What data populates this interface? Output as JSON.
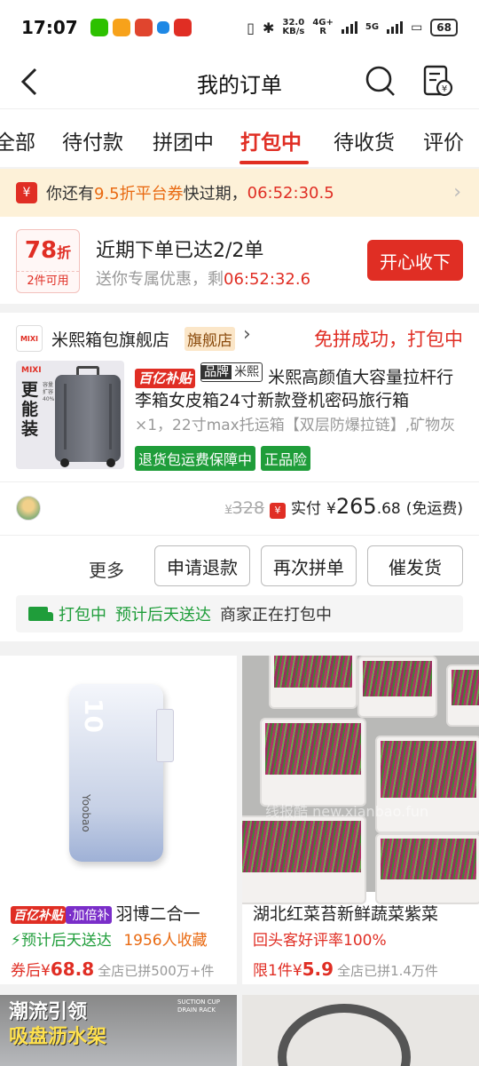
{
  "status_bar": {
    "time": "17:07",
    "net_speed": "32.0",
    "net_unit": "KB/s",
    "net_type": "4G+",
    "net_type_sub": "R",
    "wifi": "5G",
    "battery": "68"
  },
  "nav": {
    "title": "我的订单"
  },
  "tabs": [
    {
      "label": "全部"
    },
    {
      "label": "待付款"
    },
    {
      "label": "拼团中"
    },
    {
      "label": "打包中"
    },
    {
      "label": "待收货"
    },
    {
      "label": "评价"
    }
  ],
  "banner": {
    "icon": "¥",
    "prefix": "你还有",
    "highlight": "9.5折平台券",
    "middle": "快过期，",
    "countdown": "06:52:30.5"
  },
  "promo": {
    "discount": "78",
    "discount_unit": "折",
    "sub": "2件可用",
    "line1": "近期下单已达2/2单",
    "line2_prefix": "送你专属优惠，剩",
    "line2_countdown": "06:52:32.6",
    "button": "开心收下"
  },
  "order": {
    "shop_logo": "MIXI",
    "shop_name": "米熙箱包旗舰店",
    "shop_tag": "旗舰店",
    "status": "免拼成功，打包中",
    "img_brand": "MIXI",
    "img_text": "更能装",
    "img_sub": "容量扩容40%",
    "tag_bybt": "百亿补贴",
    "tag_brand_label": "品牌",
    "tag_brand_name": "米熙",
    "title": "米熙高颜值大容量拉杆行李箱女皮箱24寸新款登机密码旅行箱",
    "spec": "×1，22寸max托运箱【双层防爆拉链】,矿物灰",
    "service_tags": [
      "退货包运费保障中",
      "正品险"
    ],
    "orig_yen": "¥",
    "orig_price": "328",
    "paid_icon": "¥",
    "paid_label": "实付",
    "paid_yen": "¥",
    "paid_int": "265",
    "paid_dec": ".68",
    "shipping_note": "(免运费)",
    "more": "更多",
    "actions": [
      "申请退款",
      "再次拼单",
      "催发货"
    ],
    "ship_status": "打包中",
    "ship_eta": "预计后天送达",
    "ship_note": "商家正在打包中"
  },
  "recommendations": [
    {
      "img_num": "10",
      "img_label": "Yoobao",
      "tag1": "百亿补贴",
      "tag2": "·加倍补",
      "title": "羽博二合一",
      "bolt": "⚡",
      "eta": "预计后天送达",
      "favs": "1956人收藏",
      "price_prefix": "券后¥",
      "price": "68.8",
      "sold": "全店已拼500万+件"
    },
    {
      "watermark": "线报酷 new.xianbao.fun",
      "title": "湖北红菜苔新鲜蔬菜紫菜",
      "highlight": "回头客好评率100%",
      "price_prefix": "限1件¥",
      "price": "5.9",
      "sold": "全店已拼1.4万件"
    }
  ],
  "bottom_tiles": [
    {
      "line1": "潮流引领",
      "line2": "吸盘沥水架",
      "img_label": "SUCTION CUP DRAIN RACK"
    },
    {}
  ],
  "colors": {
    "accent": "#e02e24",
    "green": "#1f9d3a",
    "banner_bg": "#fdf1d8"
  }
}
